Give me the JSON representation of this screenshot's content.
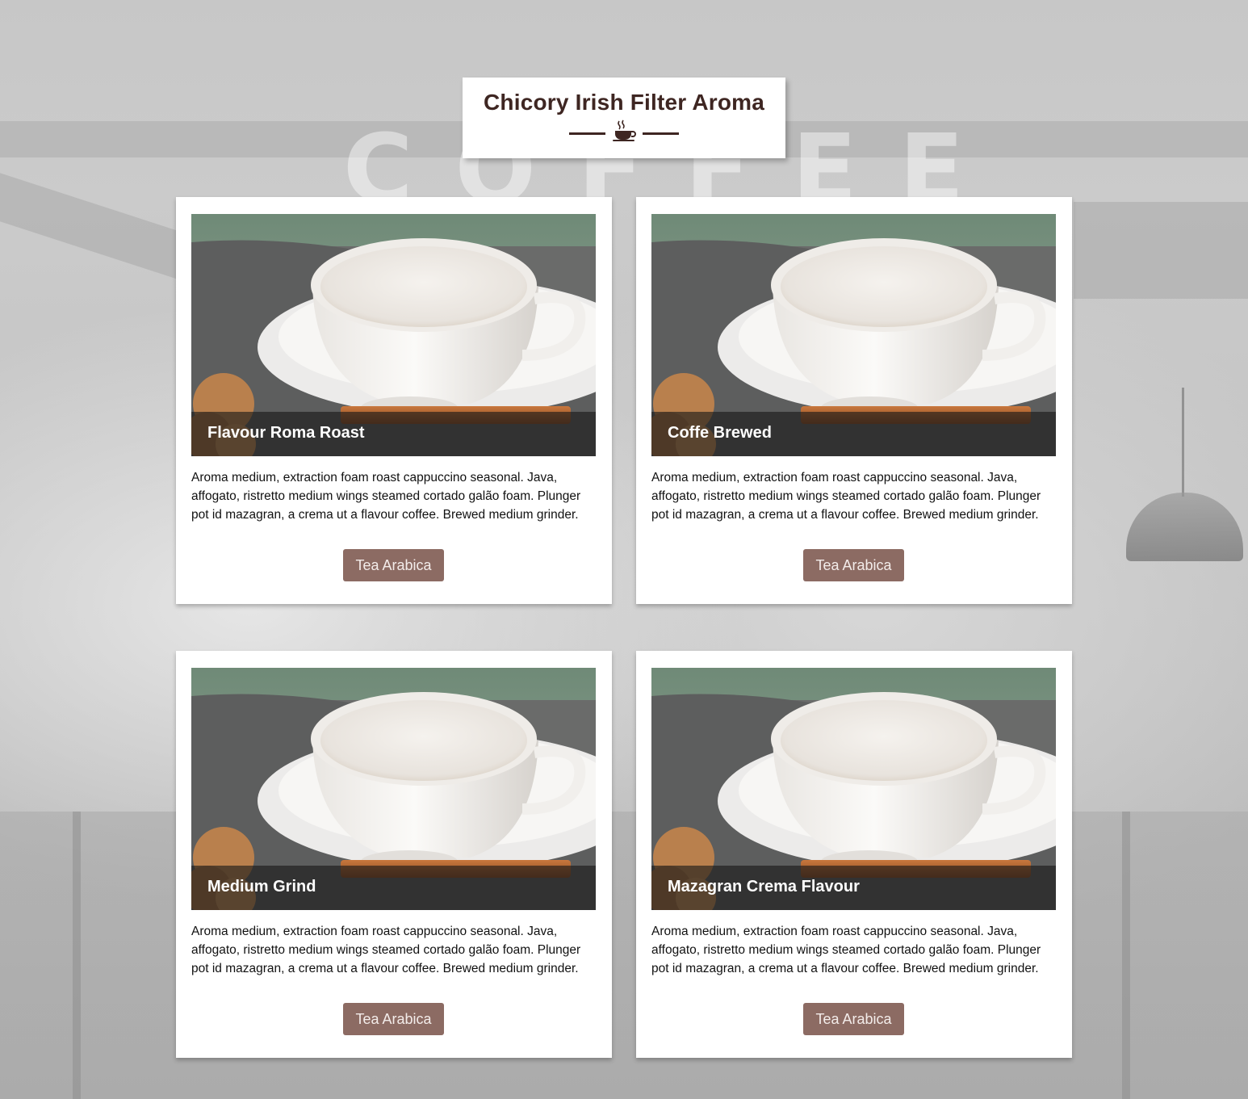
{
  "header": {
    "title": "Chicory Irish Filter Aroma",
    "divider_icon": "coffee-cup-icon"
  },
  "background": {
    "sign_text": "COFFEE"
  },
  "colors": {
    "title_text": "#3e2622",
    "button_bg": "#8c6b63",
    "button_text": "#f3ecea",
    "card_bg": "#ffffff"
  },
  "cards": [
    {
      "title": "Flavour Roma Roast",
      "description": "Aroma medium, extraction foam roast cappuccino seasonal. Java, affogato, ristretto medium wings steamed cortado galão foam. Plunger pot id mazagran, a crema ut a flavour coffee. Brewed medium grinder.",
      "button_label": "Tea Arabica"
    },
    {
      "title": "Coffe Brewed",
      "description": "Aroma medium, extraction foam roast cappuccino seasonal. Java, affogato, ristretto medium wings steamed cortado galão foam. Plunger pot id mazagran, a crema ut a flavour coffee. Brewed medium grinder.",
      "button_label": "Tea Arabica"
    },
    {
      "title": "Medium Grind",
      "description": "Aroma medium, extraction foam roast cappuccino seasonal. Java, affogato, ristretto medium wings steamed cortado galão foam. Plunger pot id mazagran, a crema ut a flavour coffee. Brewed medium grinder.",
      "button_label": "Tea Arabica"
    },
    {
      "title": "Mazagran Crema Flavour",
      "description": "Aroma medium, extraction foam roast cappuccino seasonal. Java, affogato, ristretto medium wings steamed cortado galão foam. Plunger pot id mazagran, a crema ut a flavour coffee. Brewed medium grinder.",
      "button_label": "Tea Arabica"
    }
  ]
}
